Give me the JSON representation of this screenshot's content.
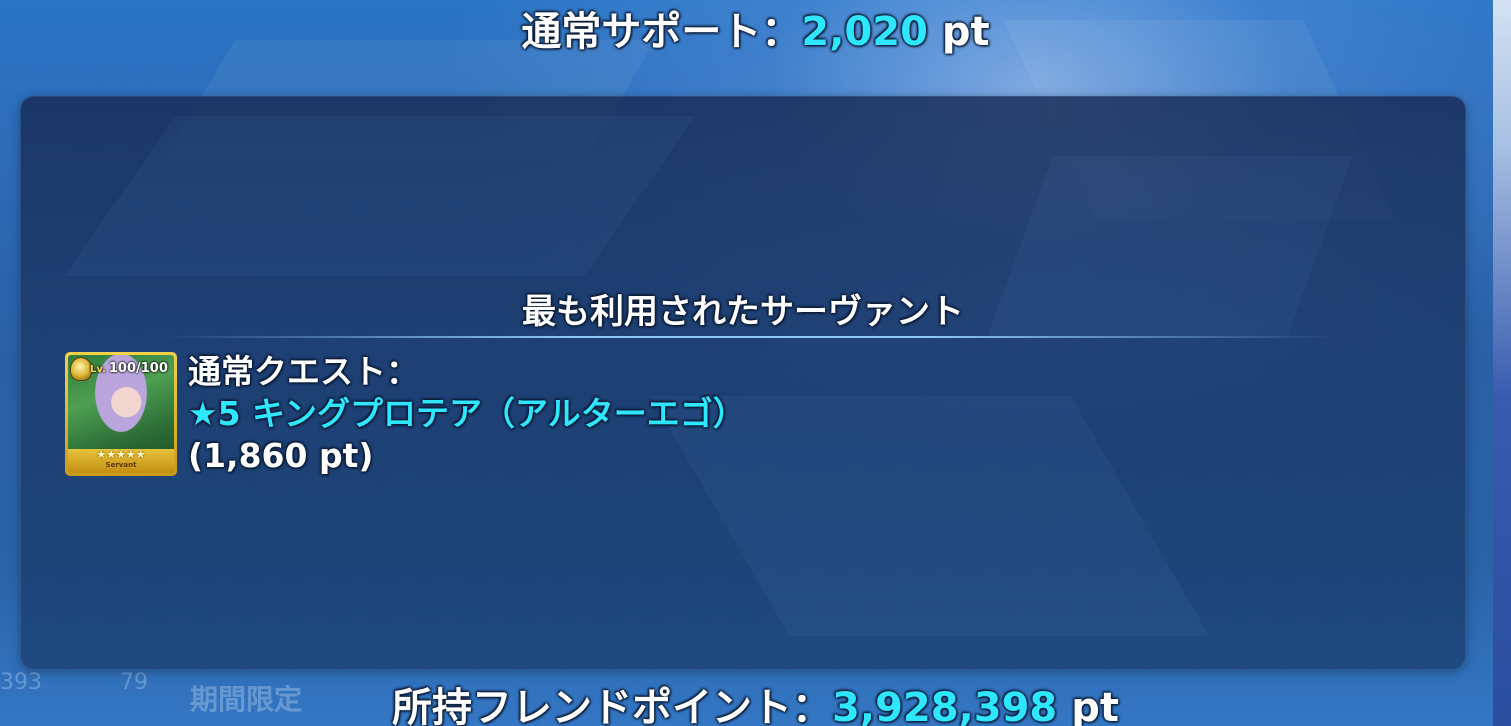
{
  "summary": {
    "support_label": "通常サポート：",
    "support_value": "2,020",
    "support_unit": " pt"
  },
  "most_used": {
    "title": "最も利用されたサーヴァント",
    "quest_label": "通常クエスト：",
    "servant_name": "★5 キングプロテア（アルターエゴ）",
    "servant_points": "(1,860 pt)",
    "card": {
      "level_prefix": "Lv.",
      "level": "100/100",
      "stars": "★★★★★",
      "type_label": "Servant"
    }
  },
  "friend_points": {
    "label": "所持フレンドポイント：",
    "value": "3,928,398",
    "unit": " pt"
  },
  "background_ghost": {
    "num_left": "393",
    "num_right": "79",
    "limited_label": "期間限定"
  },
  "colors": {
    "accent_cyan": "#2fe6ff",
    "text_white": "#ffffff",
    "card_gold": "#f2d24a"
  }
}
